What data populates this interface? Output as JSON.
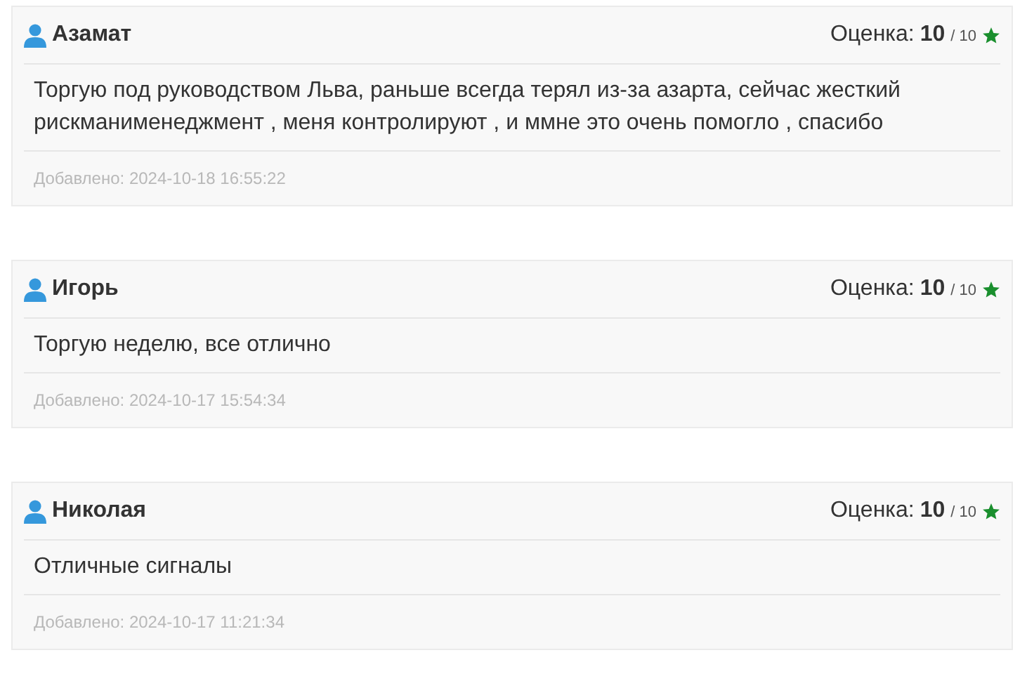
{
  "reviews": [
    {
      "author": "Азамат",
      "rating_label": "Оценка:",
      "score": "10",
      "max": "/ 10",
      "text": "Торгую под руководством Льва, раньше всегда терял из-за азарта, сейчас жесткий рискманименеджмент , меня контролируют , и ммне это очень помогло , спасибо",
      "added": "Добавлено: 2024-10-18 16:55:22"
    },
    {
      "author": "Игорь",
      "rating_label": "Оценка:",
      "score": "10",
      "max": "/ 10",
      "text": "Торгую неделю, все отлично",
      "added": "Добавлено: 2024-10-17 15:54:34"
    },
    {
      "author": "Николая",
      "rating_label": "Оценка:",
      "score": "10",
      "max": "/ 10",
      "text": "Отличные сигналы",
      "added": "Добавлено: 2024-10-17 11:21:34"
    }
  ]
}
